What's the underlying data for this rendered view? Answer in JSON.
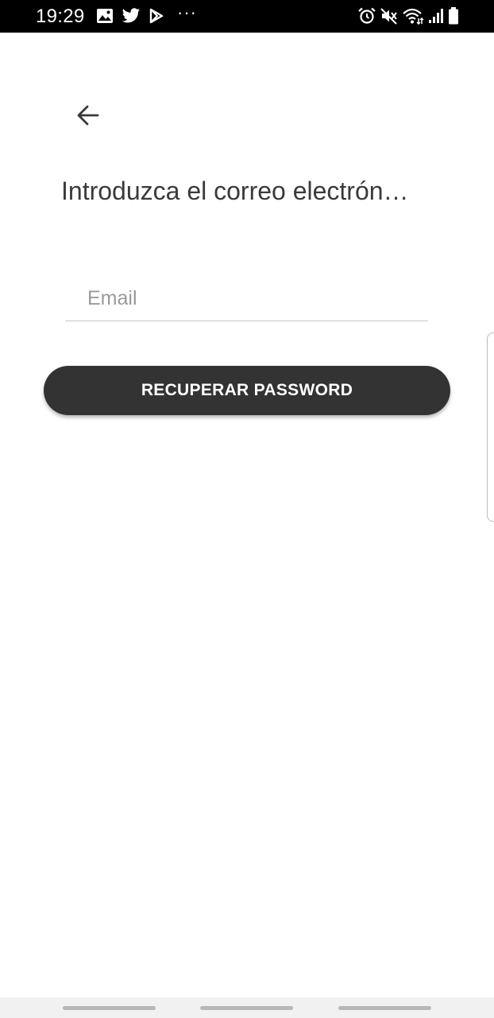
{
  "status_bar": {
    "time": "19:29",
    "more_indicator": "···",
    "left_icons": [
      "image-icon",
      "twitter-icon",
      "play-store-icon"
    ],
    "right_icons": [
      "alarm-icon",
      "mute-icon",
      "wifi-icon",
      "signal-icon",
      "battery-icon"
    ]
  },
  "header": {
    "back_icon": "arrow-left-icon",
    "title": "Introduzca el correo electrón…"
  },
  "form": {
    "email_placeholder": "Email",
    "email_value": "",
    "submit_label": "RECUPERAR PASSWORD"
  },
  "nav_bar": {
    "items": [
      "recent-apps",
      "home",
      "back"
    ]
  },
  "colors": {
    "status_bar_bg": "#000000",
    "button_bg": "#333333",
    "title_text": "#3a3a3a",
    "placeholder_text": "#9a9a9a",
    "field_underline": "#c8c8c8",
    "nav_bar_bg": "#f1f1f1"
  }
}
